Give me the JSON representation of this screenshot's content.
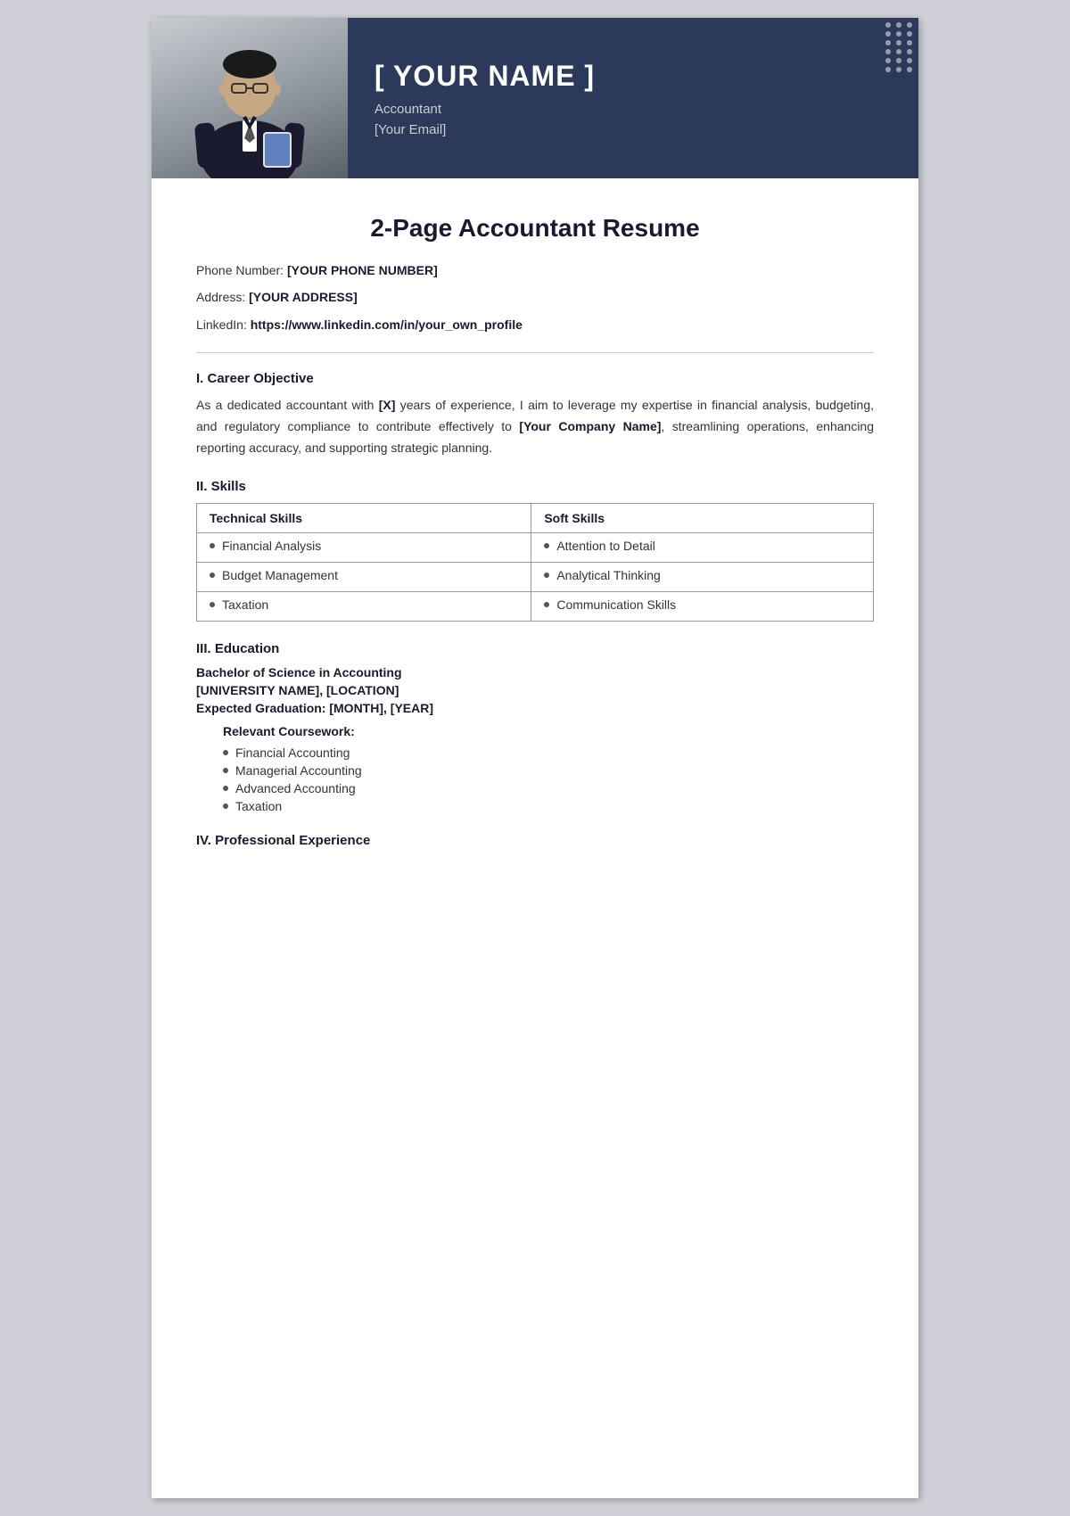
{
  "header": {
    "name": "[ YOUR NAME ]",
    "title": "Accountant",
    "email": "[Your Email]"
  },
  "dots": [
    1,
    2,
    3,
    4,
    5,
    6,
    7,
    8,
    9,
    10,
    11,
    12,
    13,
    14,
    15,
    16,
    17,
    18
  ],
  "resume": {
    "title": "2-Page Accountant Resume",
    "phone_label": "Phone Number:",
    "phone_value": "[YOUR PHONE NUMBER]",
    "address_label": "Address:",
    "address_value": "[YOUR ADDRESS]",
    "linkedin_label": "LinkedIn:",
    "linkedin_value": "https://www.linkedin.com/in/your_own_profile"
  },
  "sections": {
    "career_objective": {
      "title": "I. Career Objective",
      "body_plain": "As a dedicated accountant with ",
      "body_bold1": "[X]",
      "body_mid": " years of experience, I aim to leverage my expertise in financial analysis, budgeting, and regulatory compliance to contribute effectively to ",
      "body_bold2": "[Your Company Name]",
      "body_end": ", streamlining operations, enhancing reporting accuracy, and supporting strategic planning."
    },
    "skills": {
      "title": "II. Skills",
      "technical_header": "Technical Skills",
      "soft_header": "Soft Skills",
      "technical_items": [
        "Financial Analysis",
        "Budget Management",
        "Taxation"
      ],
      "soft_items": [
        "Attention to Detail",
        "Analytical Thinking",
        "Communication Skills"
      ]
    },
    "education": {
      "title": "III. Education",
      "degree": "Bachelor of Science in Accounting",
      "university": "[UNIVERSITY NAME], [LOCATION]",
      "graduation": "Expected Graduation: [MONTH], [YEAR]",
      "coursework_title": "Relevant Coursework:",
      "coursework_items": [
        "Financial Accounting",
        "Managerial Accounting",
        "Advanced Accounting",
        "Taxation"
      ]
    },
    "experience": {
      "title": "IV. Professional Experience"
    }
  }
}
